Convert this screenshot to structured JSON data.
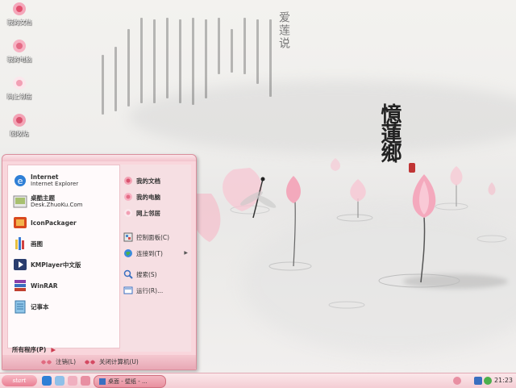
{
  "desktop": {
    "icons": [
      {
        "label": "我的文档"
      },
      {
        "label": "我的电脑"
      },
      {
        "label": "网上邻居"
      },
      {
        "label": "回收站"
      }
    ],
    "calligraphy": "憶蓮鄉",
    "poem_title": "爱莲说"
  },
  "start_menu": {
    "left_items": [
      {
        "title": "Internet",
        "subtitle": "Internet Explorer",
        "icon": "ie-icon"
      },
      {
        "title": "桌酷主题",
        "subtitle": "Desk.ZhuoKu.Com",
        "icon": "zhuoku-icon"
      },
      {
        "title": "IconPackager",
        "subtitle": "",
        "icon": "iconpackager-icon"
      },
      {
        "title": "画图",
        "subtitle": "",
        "icon": "paint-icon"
      },
      {
        "title": "KMPlayer中文版",
        "subtitle": "",
        "icon": "kmplayer-icon"
      },
      {
        "title": "WinRAR",
        "subtitle": "",
        "icon": "winrar-icon"
      },
      {
        "title": "记事本",
        "subtitle": "",
        "icon": "notepad-icon"
      }
    ],
    "all_programs": "所有程序(P)",
    "right_items": [
      {
        "label": "我的文档"
      },
      {
        "label": "我的电脑"
      },
      {
        "label": "网上邻居"
      },
      {
        "label": "控制面板(C)"
      },
      {
        "label": "连接到(T)"
      },
      {
        "label": "搜索(S)"
      },
      {
        "label": "运行(R)..."
      }
    ],
    "logoff": "注销(L)",
    "shutdown": "关闭计算机(U)"
  },
  "taskbar": {
    "start_label": "start",
    "task_label": "桌面 - 壁纸 - ...",
    "clock": "21:23"
  }
}
